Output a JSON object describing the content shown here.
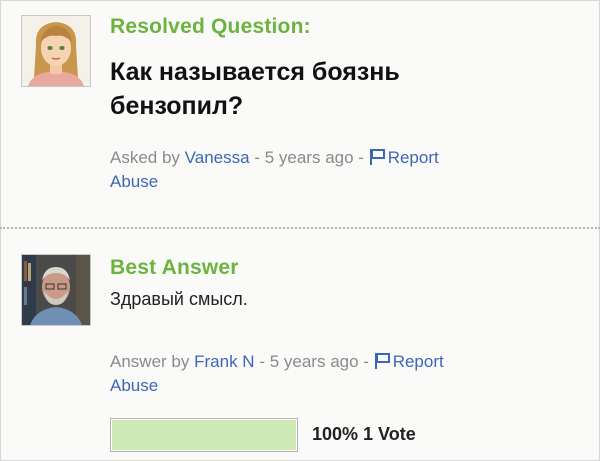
{
  "question": {
    "heading": "Resolved Question:",
    "title": "Как называется боязнь бензопил?",
    "meta": {
      "prefix": "Asked by",
      "author": "Vanessa",
      "separator1": "-",
      "time": "5 years ago",
      "separator2": "-",
      "report": "Report",
      "abuse": "Abuse"
    }
  },
  "answer": {
    "heading": "Best Answer",
    "text": "Здравый смысл.",
    "meta": {
      "prefix": "Answer by",
      "author": "Frank N",
      "separator1": "-",
      "time": "5 years ago",
      "separator2": "-",
      "report": "Report",
      "abuse": "Abuse"
    },
    "vote": {
      "percent": 100,
      "label": "100% 1 Vote"
    }
  },
  "colors": {
    "heading_green": "#6cb33f",
    "link_blue": "#3d66b5",
    "meta_gray": "#8a8a8a",
    "vote_fill": "#cde9b6"
  },
  "icons": {
    "question_avatar": "cartoon-girl-avatar-icon",
    "answer_avatar": "man-photo-avatar-icon",
    "report": "flag-icon"
  }
}
